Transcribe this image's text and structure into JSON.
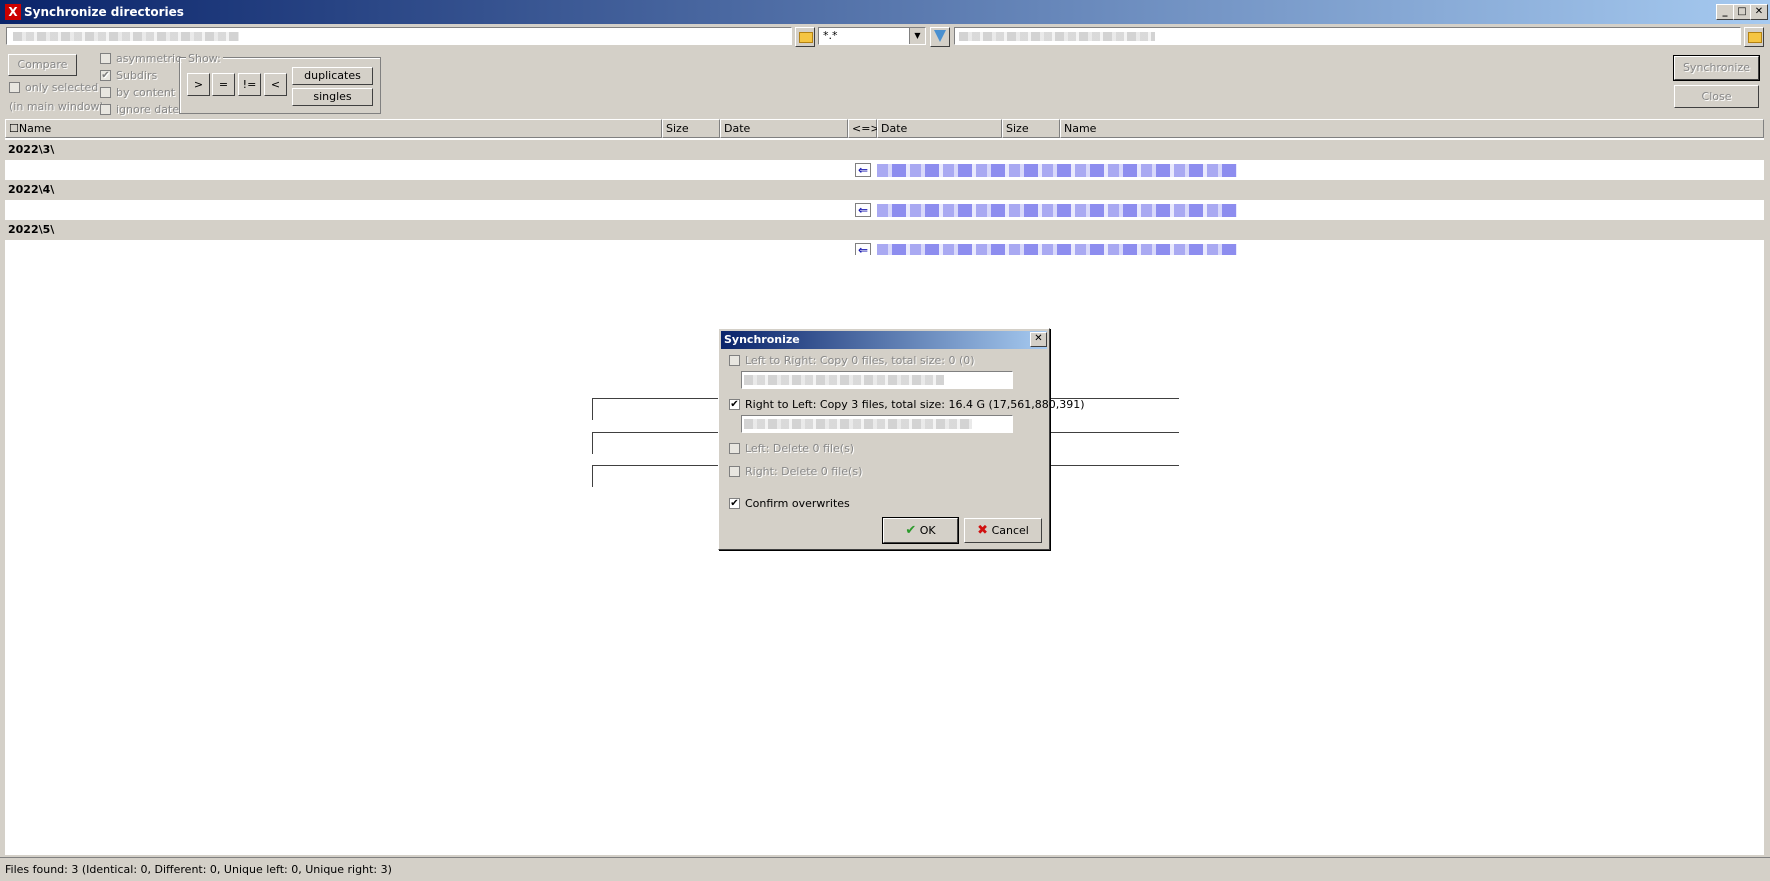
{
  "window": {
    "title": "Synchronize directories",
    "controls": [
      "_",
      "□",
      "✕"
    ]
  },
  "toolbar": {
    "filter_value": "*.*",
    "compare_label": "Compare",
    "synchronize_label": "Synchronize",
    "close_label": "Close",
    "asymmetric_label": "asymmetric",
    "subdirs_label": "Subdirs",
    "by_content_label": "by content",
    "ignore_date_label": "ignore date",
    "only_selected_label": "only selected",
    "in_main_window_label": "(in main window)",
    "show_label": "Show:",
    "show_buttons": [
      ">",
      "=",
      "!=",
      "<"
    ],
    "duplicates_label": "duplicates",
    "singles_label": "singles"
  },
  "grid": {
    "headers": [
      "Name",
      "Size",
      "Date",
      "<=>",
      "Date",
      "Size",
      "Name"
    ],
    "directories": [
      "2022\\3\\",
      "2022\\4\\",
      "2022\\5\\"
    ],
    "arrow_glyph": "⇐"
  },
  "status": {
    "text": "Files found: 3  (Identical: 0, Different: 0, Unique left: 0, Unique right: 3)"
  },
  "dialog": {
    "title": "Synchronize",
    "left_to_right": "Left to Right: Copy 0 files, total size: 0 (0)",
    "right_to_left": "Right to Left: Copy 3 files, total size: 16.4 G (17,561,880,391)",
    "left_delete": "Left: Delete 0 file(s)",
    "right_delete": "Right: Delete 0 file(s)",
    "confirm_overwrites": "Confirm overwrites",
    "ok_label": "OK",
    "cancel_label": "Cancel"
  },
  "colors": {
    "title_start": "#0a246a",
    "title_end": "#a6caf0",
    "face": "#d4d0c8",
    "arrow": "#1a1ab0",
    "ok_check": "#2a9a2a",
    "cancel_x": "#d01010"
  }
}
